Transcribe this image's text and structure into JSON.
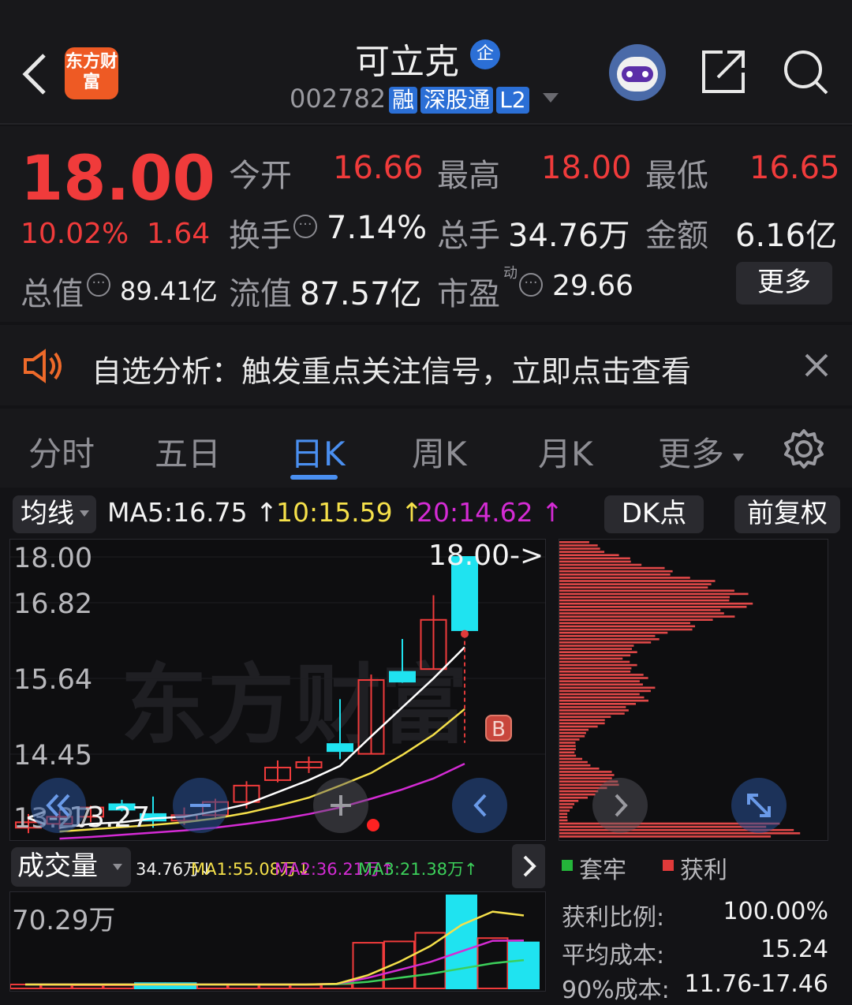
{
  "header": {
    "back_icon": "chevron-left-icon",
    "app_logo_text": "东方财富",
    "stock_name": "可立克",
    "enterprise_badge": "企",
    "stock_code": "002782",
    "badges": [
      "融",
      "深股通",
      "L2"
    ],
    "share_icon": "share-icon",
    "search_icon": "search-icon",
    "avatar_icon": "robot-avatar-icon"
  },
  "quote": {
    "price": "18.00",
    "change_pct": "10.02%",
    "change_amt": "1.64",
    "open_label": "今开",
    "open_value": "16.66",
    "high_label": "最高",
    "high_value": "18.00",
    "low_label": "最低",
    "low_value": "16.65",
    "turnover_label": "换手",
    "turnover_value": "7.14%",
    "volume_label": "总手",
    "volume_value": "34.76万",
    "amount_label": "金额",
    "amount_value": "6.16亿",
    "mktcap_label": "总值",
    "mktcap_value": "89.41亿",
    "float_label": "流值",
    "float_value": "87.57亿",
    "pe_label": "市盈",
    "pe_superscript": "动",
    "pe_value": "29.66",
    "more_button": "更多"
  },
  "notice": {
    "speaker_icon": "speaker-icon",
    "text": "自选分析：触发重点关注信号，立即点击查看",
    "close_icon": "close-icon"
  },
  "tabs": {
    "items": [
      "分时",
      "五日",
      "日K",
      "周K",
      "月K",
      "更多"
    ],
    "active": "日K",
    "settings_icon": "gear-icon"
  },
  "ma_bar": {
    "selector": "均线",
    "ma5": "MA5:16.75",
    "ma10": "10:15.59",
    "ma20": "20:14.62",
    "dk_button": "DK点",
    "adjust_button": "前复权"
  },
  "kline": {
    "y_labels": [
      "18.00",
      "16.82",
      "15.64",
      "14.45",
      "13.27"
    ],
    "high_marker": "18.00->",
    "low_marker": "<--13.27",
    "b_marker": "B",
    "watermark": "东方财富"
  },
  "volume_bar": {
    "selector": "成交量",
    "vol": "34.76万",
    "ma1": "MA1:55.08万",
    "ma2": "MA2:36.21万",
    "ma3": "MA3:21.38万",
    "y_label": "70.29万"
  },
  "chip": {
    "legend_trapped": "套牢",
    "legend_profit": "获利",
    "profit_ratio_label": "获利比例:",
    "profit_ratio_value": "100.00%",
    "avg_cost_label": "平均成本:",
    "avg_cost_value": "15.24",
    "cost90_label": "90%成本:",
    "cost90_value": "11.76-17.46"
  },
  "colors": {
    "up": "#f03b3b",
    "down": "#1fe3f0",
    "ma5": "#ffffff",
    "ma10": "#f5e04a",
    "ma20": "#d42bd4",
    "accent": "#4a8ff0"
  },
  "chart_data": {
    "type": "candlestick",
    "ylim": [
      13.27,
      18.0
    ],
    "candles": [
      {
        "o": 13.05,
        "h": 13.3,
        "l": 12.95,
        "c": 13.15
      },
      {
        "o": 13.12,
        "h": 13.35,
        "l": 13.02,
        "c": 13.25
      },
      {
        "o": 13.25,
        "h": 13.45,
        "l": 13.15,
        "c": 13.42
      },
      {
        "o": 13.48,
        "h": 13.56,
        "l": 13.35,
        "c": 13.38
      },
      {
        "o": 13.3,
        "h": 13.62,
        "l": 13.05,
        "c": 13.18
      },
      {
        "o": 13.18,
        "h": 13.42,
        "l": 13.1,
        "c": 13.28
      },
      {
        "o": 13.28,
        "h": 13.58,
        "l": 13.2,
        "c": 13.52
      },
      {
        "o": 13.52,
        "h": 13.9,
        "l": 13.4,
        "c": 13.82
      },
      {
        "o": 13.92,
        "h": 14.28,
        "l": 13.88,
        "c": 14.15
      },
      {
        "o": 14.15,
        "h": 14.35,
        "l": 14.05,
        "c": 14.25
      },
      {
        "o": 14.58,
        "h": 15.4,
        "l": 14.3,
        "c": 14.45
      },
      {
        "o": 14.4,
        "h": 15.85,
        "l": 14.4,
        "c": 15.75
      },
      {
        "o": 15.72,
        "h": 16.5,
        "l": 15.7,
        "c": 15.9
      },
      {
        "o": 15.95,
        "h": 17.3,
        "l": 15.95,
        "c": 16.85
      },
      {
        "o": 16.66,
        "h": 18.0,
        "l": 16.65,
        "c": 18.0
      }
    ],
    "candle_colors": [
      "up",
      "up",
      "up",
      "down",
      "down",
      "up",
      "up",
      "up",
      "up",
      "up",
      "down",
      "up",
      "down",
      "up",
      "down"
    ],
    "ma5": [
      13.05,
      13.12,
      13.15,
      13.22,
      13.25,
      13.35,
      13.48,
      13.7,
      13.92,
      14.18,
      14.72,
      15.25,
      15.78,
      16.35
    ],
    "ma10": [
      12.98,
      13.02,
      13.06,
      13.1,
      13.15,
      13.22,
      13.32,
      13.45,
      13.6,
      13.82,
      14.05,
      14.38,
      14.75,
      15.22
    ],
    "ma20": [
      12.85,
      12.88,
      12.92,
      12.96,
      13.0,
      13.05,
      13.12,
      13.2,
      13.3,
      13.42,
      13.58,
      13.75,
      13.95,
      14.22
    ],
    "volumes": [
      3.0,
      2.6,
      2.4,
      2.4,
      4.0,
      4.0,
      2.8,
      2.8,
      2.6,
      2.6,
      3.2,
      34.5,
      35.5,
      42.0,
      70.29,
      38.0,
      34.76
    ],
    "volume_colors": [
      "up",
      "up",
      "up",
      "up",
      "down",
      "down",
      "up",
      "up",
      "up",
      "up",
      "up",
      "up",
      "up",
      "up",
      "down",
      "up",
      "down"
    ],
    "vol_ma1": [
      3,
      3,
      3,
      3,
      3,
      3,
      3,
      3,
      3,
      3,
      3.5,
      10,
      20,
      32,
      48,
      58,
      55.08
    ],
    "vol_ma2": [
      3,
      3,
      3,
      3,
      3,
      3,
      3,
      3,
      3,
      3,
      3.5,
      8,
      14,
      20,
      28,
      36,
      36.21
    ],
    "vol_ma3": [
      3,
      3,
      3,
      3,
      3,
      3,
      3,
      3,
      3,
      3,
      3.2,
      5,
      8,
      11,
      15,
      19,
      21.38
    ],
    "vol_ylim": [
      0,
      70.29
    ]
  }
}
